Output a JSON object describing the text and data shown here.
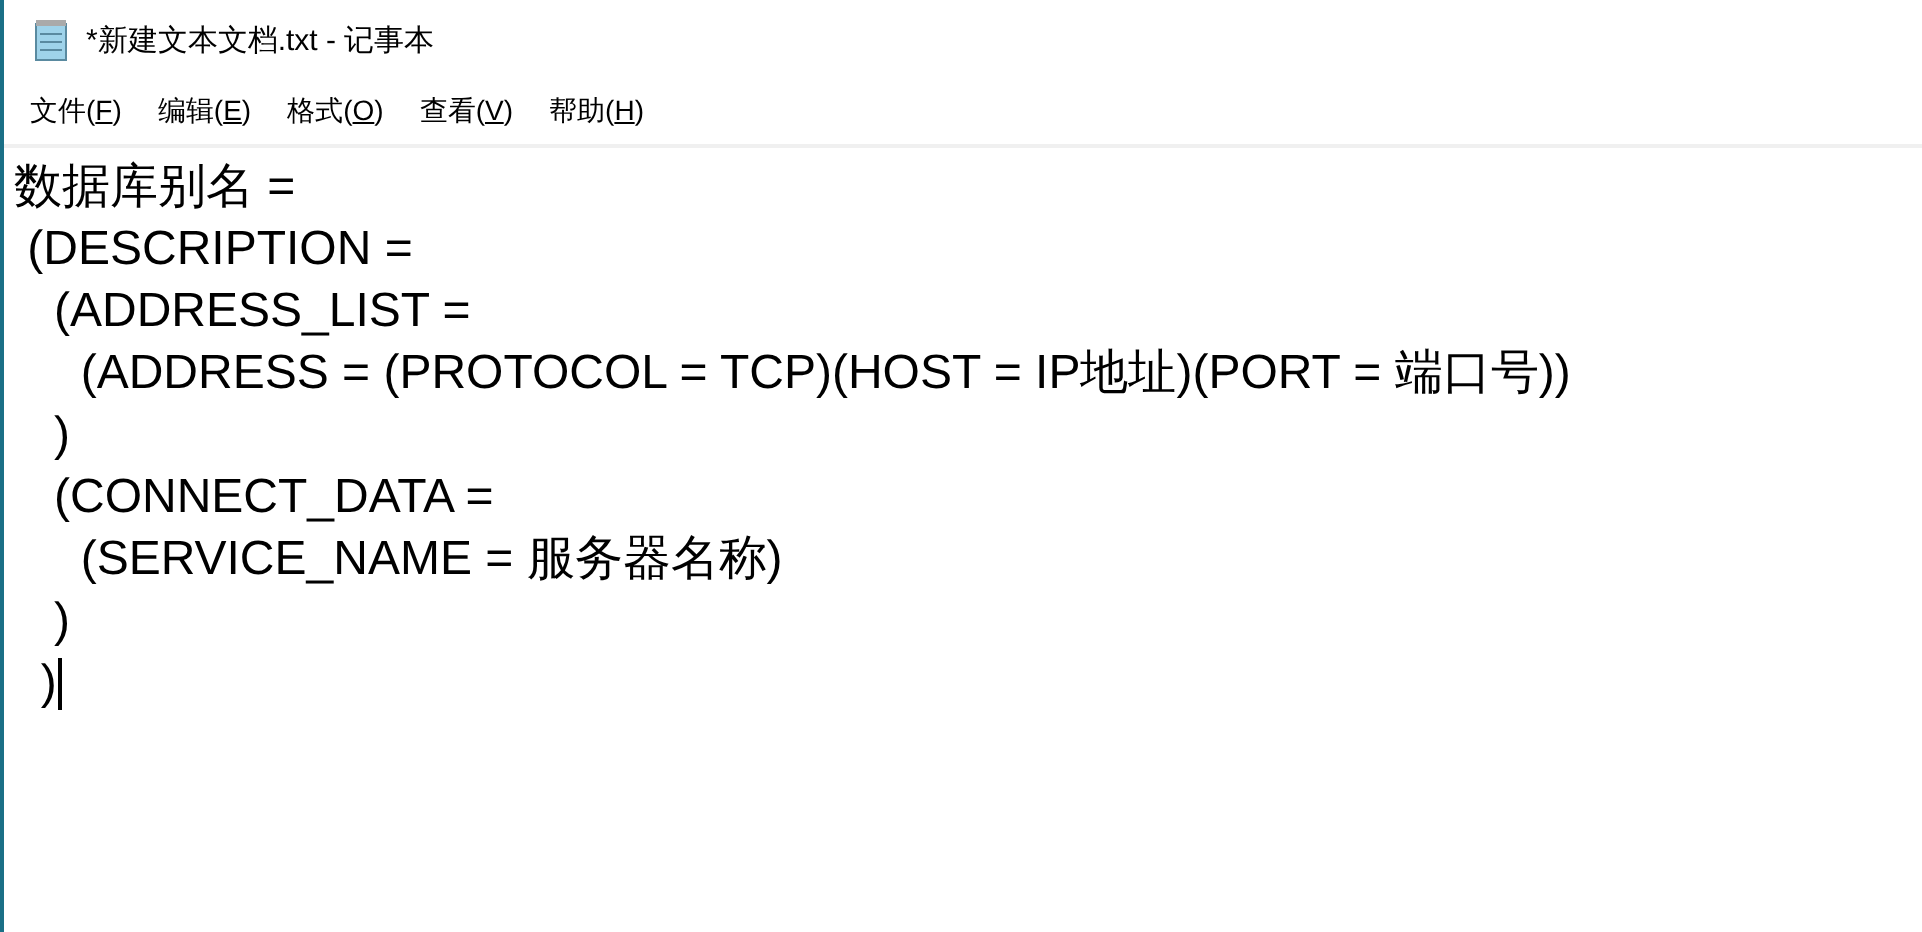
{
  "window": {
    "title": "*新建文本文档.txt - 记事本"
  },
  "menu": [
    {
      "label": "文件(F)"
    },
    {
      "label": "编辑(E)"
    },
    {
      "label": "格式(O)"
    },
    {
      "label": "查看(V)"
    },
    {
      "label": "帮助(H)"
    }
  ],
  "editor": {
    "lines": [
      {
        "text": "数据库别名 =",
        "caret": false
      },
      {
        "text": " (DESCRIPTION =",
        "caret": false
      },
      {
        "text": "   (ADDRESS_LIST =",
        "caret": false
      },
      {
        "text": "     (ADDRESS = (PROTOCOL = TCP)(HOST = IP地址)(PORT = 端口号))",
        "caret": false
      },
      {
        "text": "   )",
        "caret": false
      },
      {
        "text": "   (CONNECT_DATA =",
        "caret": false
      },
      {
        "text": "     (SERVICE_NAME = 服务器名称)",
        "caret": false
      },
      {
        "text": "   )",
        "caret": false
      },
      {
        "text": "  )",
        "caret": true
      }
    ]
  }
}
